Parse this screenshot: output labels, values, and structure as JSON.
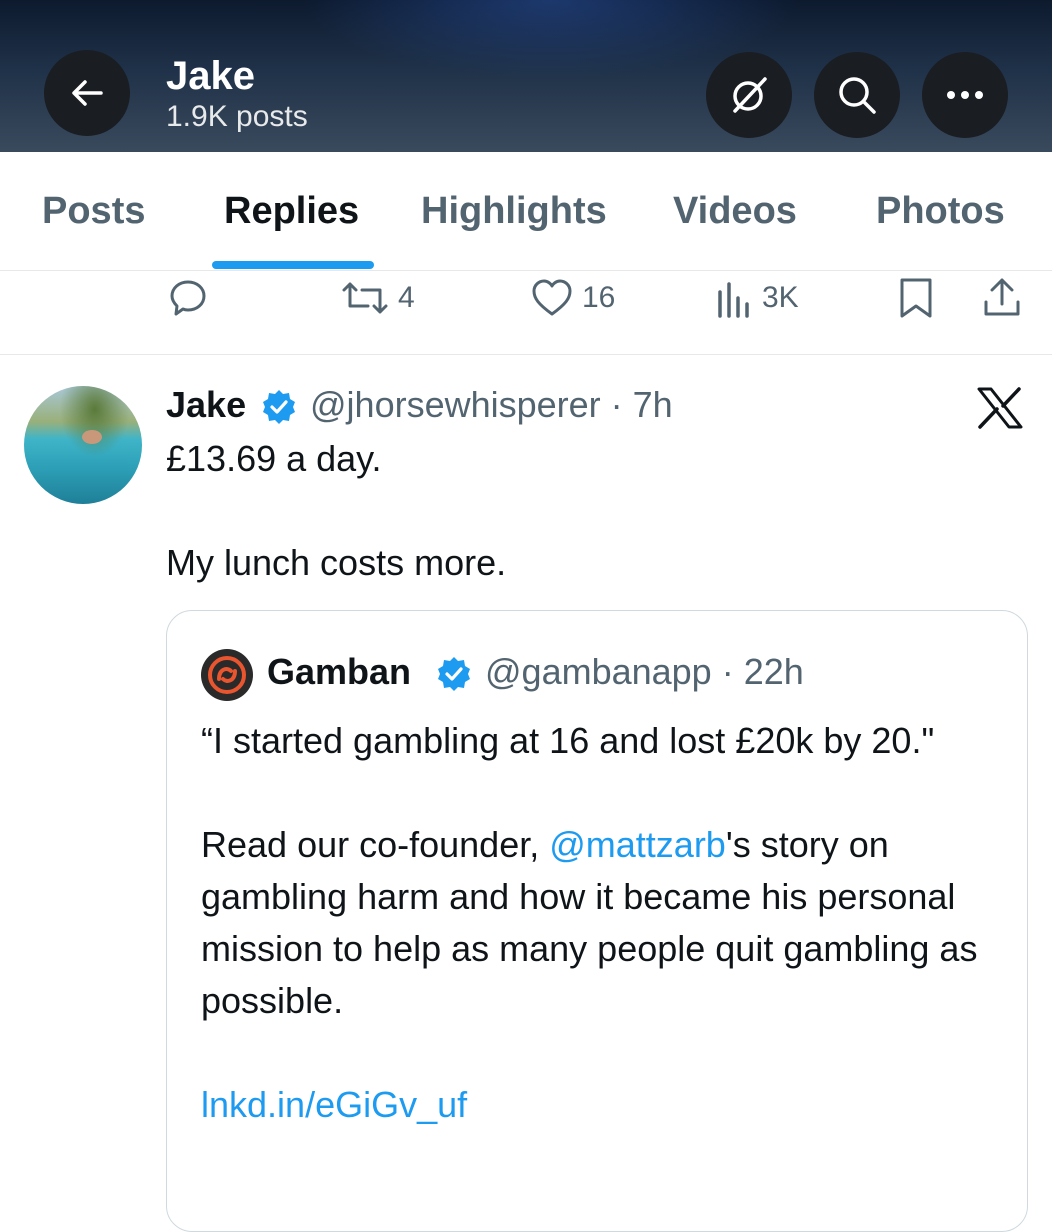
{
  "header": {
    "back_icon": "arrow-left-icon",
    "name": "Jake",
    "posts_count": "1.9K posts",
    "grok_icon": "grok-icon",
    "search_icon": "search-icon",
    "more_icon": "more-icon"
  },
  "tabs": [
    {
      "label": "Posts",
      "active": false
    },
    {
      "label": "Replies",
      "active": true
    },
    {
      "label": "Highlights",
      "active": false
    },
    {
      "label": "Videos",
      "active": false
    },
    {
      "label": "Photos",
      "active": false
    }
  ],
  "prev_tweet_actions": {
    "reply_count": "",
    "retweet_count": "4",
    "like_count": "16",
    "views_count": "3K"
  },
  "tweet": {
    "author_name": "Jake",
    "handle_time": "@jhorsewhisperer · 7h",
    "line1": "£13.69 a day.",
    "line2": "My lunch costs more."
  },
  "quote": {
    "author_name": "Gamban",
    "handle_time": "@gambanapp · 22h",
    "para1": "“I started gambling at 16 and lost £20k by 20.\"",
    "para2_before": "Read our co-founder, ",
    "para2_mention": "@mattzarb",
    "para2_after": "'s story on gambling harm and how it became his personal mission to help as many people quit gambling as possible.",
    "link": "lnkd.in/eGiGv_uf"
  },
  "colors": {
    "accent": "#1d9bf0",
    "secondary_text": "#536471",
    "primary_text": "#0f1419"
  }
}
